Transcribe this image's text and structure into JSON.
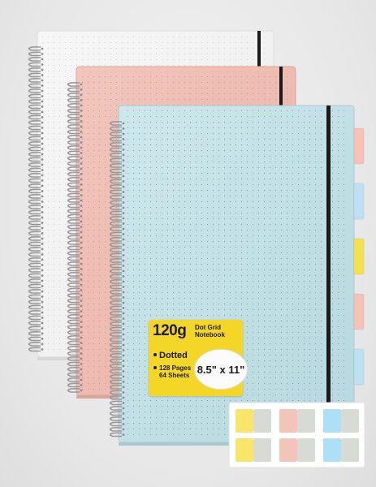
{
  "product": {
    "image_subject": "Stack of three spiral-bound dot grid notebooks",
    "covers": [
      {
        "name": "white-notebook",
        "color": "#f2f2f2"
      },
      {
        "name": "pink-notebook",
        "color": "#efbcb2"
      },
      {
        "name": "blue-notebook",
        "color": "#c3e2e8"
      }
    ],
    "tab_colors": [
      "#f7c1b5",
      "#bfe0f2",
      "#f6e04d",
      "#f7c1b5",
      "#bfe0f2"
    ],
    "sticker_colors": [
      "#f8e56a",
      "#f3c4b9",
      "#d8dbd5",
      "#ade0f7"
    ]
  },
  "label": {
    "gsm": "120g",
    "type_line1": "Dot Grid",
    "type_line2": "Notebook",
    "feature1": "Dotted",
    "feature2_line1": "128 Pages",
    "feature2_line2": "64 Sheets",
    "size": "8.5\" x 11\"",
    "background": "#f4d626"
  }
}
